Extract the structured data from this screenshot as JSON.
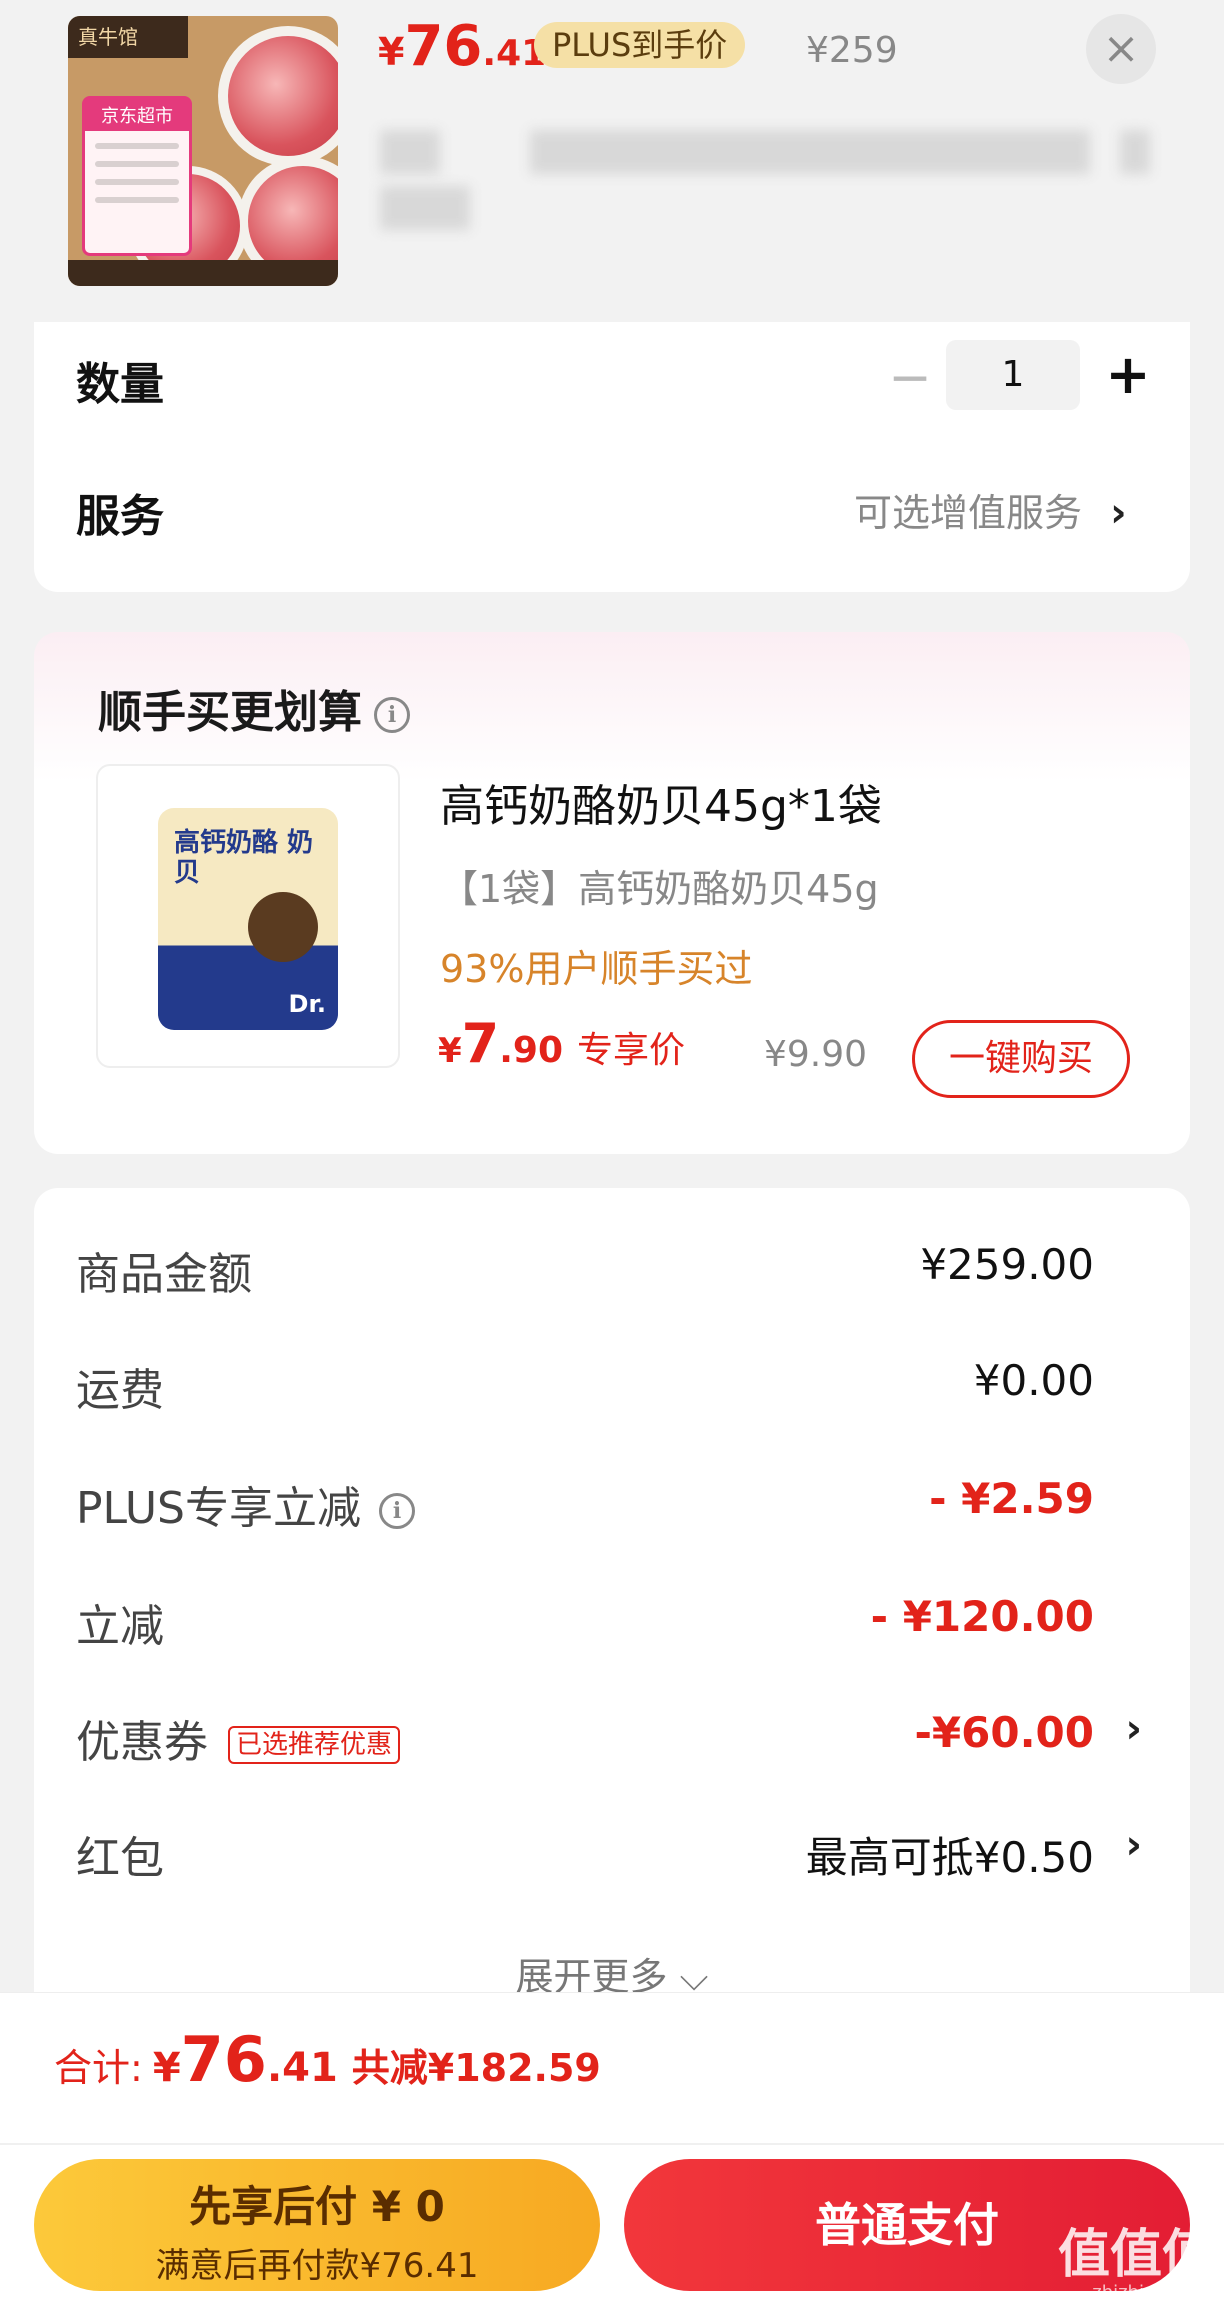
{
  "header": {
    "product_image_alt": "京东超市",
    "price_symbol": "¥",
    "price_int": "76",
    "price_dec": ".41",
    "plus_tag": "PLUS到手价",
    "original_price": "¥259",
    "close_icon": "close-icon"
  },
  "options": {
    "quantity_label": "数量",
    "quantity_value": "1",
    "minus_icon": "−",
    "plus_icon": "+",
    "service_label": "服务",
    "service_link": "可选增值服务",
    "chevron": "›"
  },
  "addon": {
    "title": "顺手买更划算",
    "info_icon": "i",
    "bag_text": "高钙奶酪 奶贝",
    "bag_brand": "Dr.",
    "name": "高钙奶酪奶贝45g*1袋",
    "spec": "【1袋】高钙奶酪奶贝45g",
    "stat": "93%用户顺手买过",
    "price_symbol": "¥",
    "price_int": "7",
    "price_dec": ".90",
    "price_tag": "专享价",
    "original_price": "¥9.90",
    "buy_button": "一键购买"
  },
  "breakdown": {
    "rows": [
      {
        "label": "商品金额",
        "value": "¥259.00"
      },
      {
        "label": "运费",
        "value": "¥0.00"
      },
      {
        "label": "PLUS专享立减",
        "value": "- ¥2.59"
      },
      {
        "label": "立减",
        "value": "- ¥120.00"
      },
      {
        "label": "优惠券",
        "tag": "已选推荐优惠",
        "value": "-¥60.00"
      },
      {
        "label": "红包",
        "value": "最高可抵¥0.50"
      }
    ],
    "expand": "展开更多 ⌵"
  },
  "bottom": {
    "total_label": "合计:",
    "total_symbol": "¥",
    "total_int": "76",
    "total_dec": ".41",
    "total_saved": "共减¥182.59",
    "later_line1": "先享后付 ¥ 0",
    "later_line2": "满意后再付款¥76.41",
    "pay_button": "普通支付"
  },
  "watermark": {
    "text": "值值值",
    "site": "zhizhizhi.com"
  },
  "colors": {
    "accent_red": "#e2231a",
    "plus_gold": "#f5e0a6",
    "later_yellow": "#fcc93a",
    "stat_orange": "#d7842a"
  }
}
